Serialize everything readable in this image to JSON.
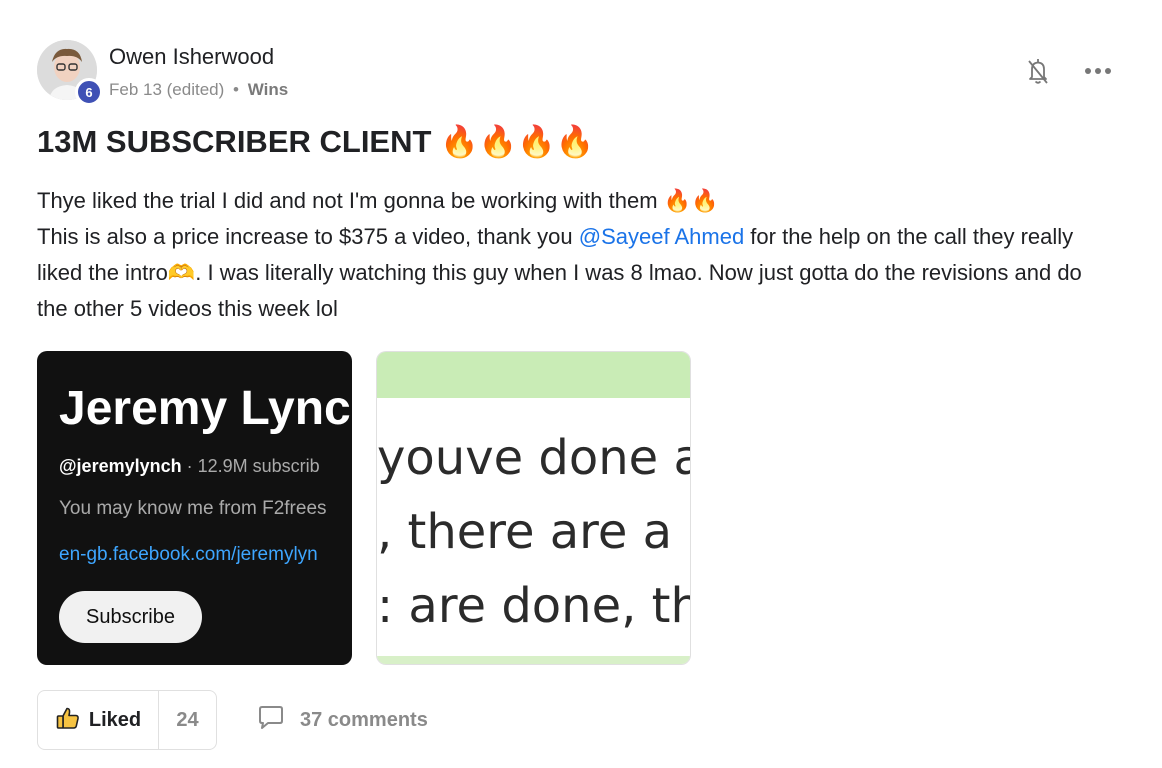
{
  "post": {
    "author": "Owen Isherwood",
    "level": "6",
    "date": "Feb 13 (edited)",
    "separator": "•",
    "category": "Wins",
    "title": "13M SUBSCRIBER CLIENT 🔥🔥🔥🔥",
    "body": {
      "line1": "Thye liked the trial I did and not I'm gonna be working with them 🔥🔥",
      "line2_before": "This is also a price increase to $375 a video, thank you ",
      "mention": "@Sayeef Ahmed",
      "line2_after": " for the help on the call they really liked the intro🫶. I was literally watching this guy when I was 8 lmao. Now just gotta do the revisions and do the other 5 videos this week lol"
    }
  },
  "attachments": {
    "channel": {
      "name": "Jeremy Lync",
      "handle": "@jeremylynch",
      "subs": " · 12.9M subscrib",
      "description": "You may know me from F2frees",
      "link": "en-gb.facebook.com/jeremylyn",
      "subscribe_label": "Subscribe"
    },
    "message": {
      "lines": [
        "youve done a",
        ", there are a r",
        ": are done, th"
      ]
    }
  },
  "actions": {
    "like_label": "Liked",
    "like_count": "24",
    "comments_label": "37 comments"
  },
  "icons": {
    "bell": "bell-off-icon",
    "more": "more-horizontal-icon",
    "like": "thumbs-up-icon",
    "comment": "comment-bubble-icon"
  },
  "colors": {
    "mention": "#1a73e8",
    "level_badge": "#3f51b5",
    "muted_text": "#8a8a8a"
  }
}
